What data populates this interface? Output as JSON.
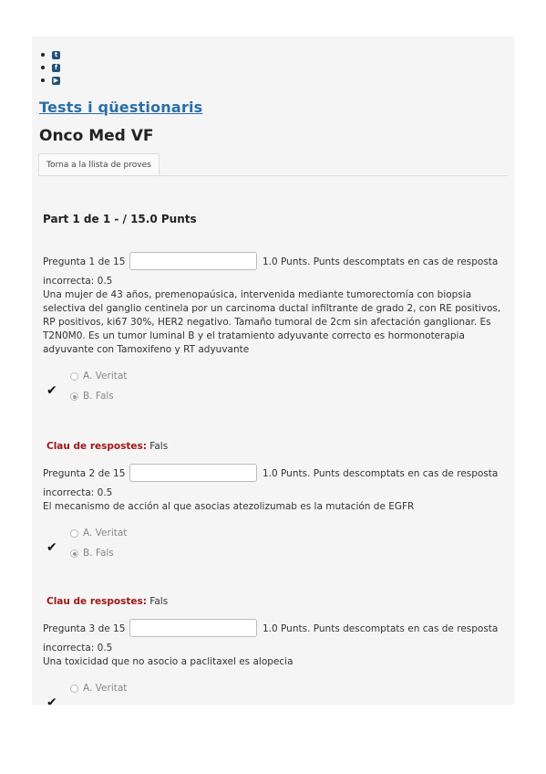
{
  "social": [
    {
      "icon": "twitter-icon",
      "glyph": "t"
    },
    {
      "icon": "facebook-icon",
      "glyph": "f"
    },
    {
      "icon": "youtube-icon",
      "glyph": "▶"
    }
  ],
  "header": {
    "site_title": "Tests i qüestionaris",
    "quiz_title": "Onco Med VF",
    "back_tab": "Torna a la llista de proves"
  },
  "part_title": "Part 1 de 1 - / 15.0 Punts",
  "key_label": "Clau de respostes:",
  "questions": [
    {
      "label": "Pregunta 1 de 15",
      "points": "1.0 Punts. Punts descomptats en cas de resposta",
      "penalty": "incorrecta: 0.5",
      "text": "Una mujer de 43 años, premenopaúsica, intervenida mediante tumorectomía con biopsia selectiva del ganglio centinela por un carcinoma ductal infiltrante de grado 2, con RE positivos, RP positivos, ki67 30%, HER2 negativo. Tamaño tumoral de 2cm sin afectación ganglionar. Es T2N0M0. Es un tumor luminal B y el tratamiento adyuvante correcto es hormonoterapia adyuvante con Tamoxifeno y RT adyuvante",
      "option_a": "A. Veritat",
      "option_b": "B. Fals",
      "key_value": "Fals"
    },
    {
      "label": "Pregunta 2 de 15",
      "points": "1.0 Punts. Punts descomptats en cas de resposta",
      "penalty": "incorrecta: 0.5",
      "text": "El mecanismo de acción al que asocias atezolizumab es la mutación de EGFR",
      "option_a": "A. Veritat",
      "option_b": "B. Fals",
      "key_value": "Fals"
    },
    {
      "label": "Pregunta 3 de 15",
      "points": "1.0 Punts. Punts descomptats en cas de resposta",
      "penalty": "incorrecta: 0.5",
      "text": "Una toxicidad que no asocio a paclitaxel es alopecia",
      "option_a": "A. Veritat"
    }
  ]
}
